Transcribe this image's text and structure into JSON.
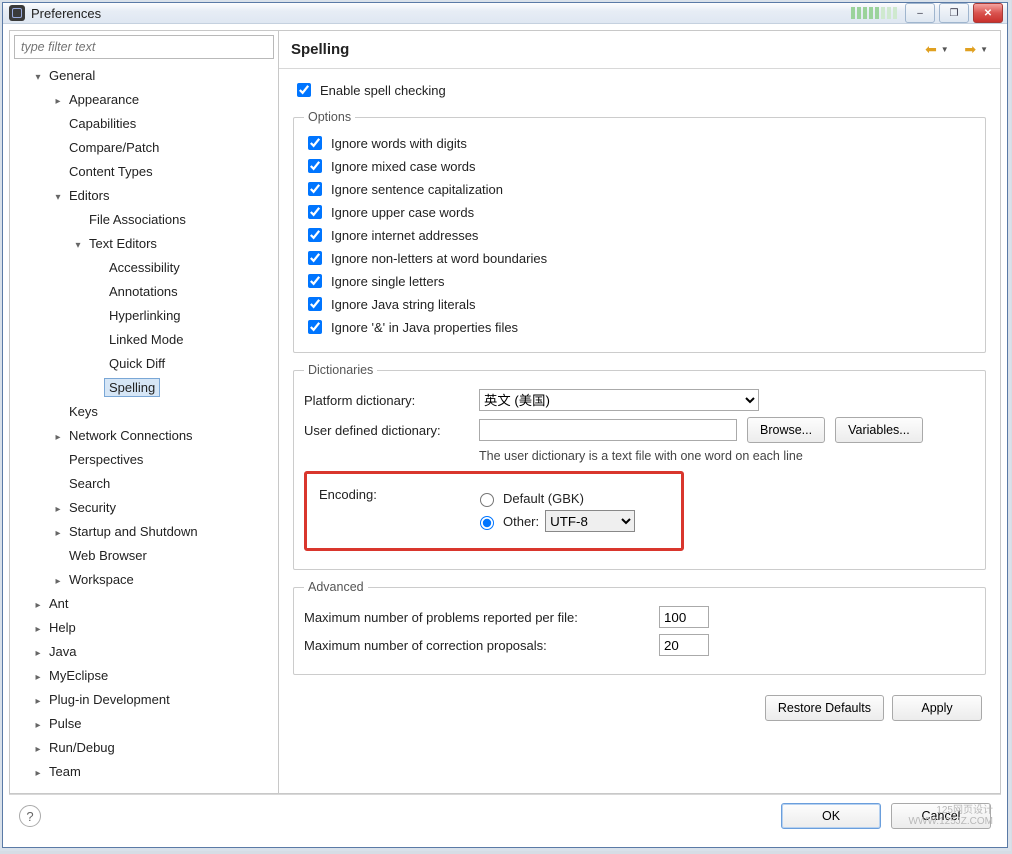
{
  "window": {
    "title": "Preferences"
  },
  "titlebar_buttons": {
    "min": "–",
    "max": "❐",
    "close": "✕"
  },
  "filter_placeholder": "type filter text",
  "tree": {
    "general": "General",
    "appearance": "Appearance",
    "capabilities": "Capabilities",
    "compare_patch": "Compare/Patch",
    "content_types": "Content Types",
    "editors": "Editors",
    "file_assoc": "File Associations",
    "text_editors": "Text Editors",
    "accessibility": "Accessibility",
    "annotations": "Annotations",
    "hyperlinking": "Hyperlinking",
    "linked_mode": "Linked Mode",
    "quick_diff": "Quick Diff",
    "spelling": "Spelling",
    "keys": "Keys",
    "network": "Network Connections",
    "perspectives": "Perspectives",
    "search": "Search",
    "security": "Security",
    "startup": "Startup and Shutdown",
    "web_browser": "Web Browser",
    "workspace": "Workspace",
    "ant": "Ant",
    "help": "Help",
    "java": "Java",
    "myeclipse": "MyEclipse",
    "plugin_dev": "Plug-in Development",
    "pulse": "Pulse",
    "run_debug": "Run/Debug",
    "team": "Team"
  },
  "page_title": "Spelling",
  "enable_label": "Enable spell checking",
  "options": {
    "legend": "Options",
    "digits": "Ignore words with digits",
    "mixed": "Ignore mixed case words",
    "sentence": "Ignore sentence capitalization",
    "upper": "Ignore upper case words",
    "internet": "Ignore internet addresses",
    "nonletters": "Ignore non-letters at word boundaries",
    "single": "Ignore single letters",
    "javastr": "Ignore Java string literals",
    "amp": "Ignore '&' in Java properties files"
  },
  "dictionaries": {
    "legend": "Dictionaries",
    "platform_label": "Platform dictionary:",
    "platform_value": "英文 (美国)",
    "user_label": "User defined dictionary:",
    "browse": "Browse...",
    "variables": "Variables...",
    "hint": "The user dictionary is a text file with one word on each line"
  },
  "encoding": {
    "label": "Encoding:",
    "default_label": "Default (GBK)",
    "other_label": "Other:",
    "other_value": "UTF-8"
  },
  "advanced": {
    "legend": "Advanced",
    "max_problems_label": "Maximum number of problems reported per file:",
    "max_problems_value": "100",
    "max_proposals_label": "Maximum number of correction proposals:",
    "max_proposals_value": "20"
  },
  "buttons": {
    "restore": "Restore Defaults",
    "apply": "Apply",
    "ok": "OK",
    "cancel": "Cancel"
  },
  "watermark": {
    "l1": "125网页设计",
    "l2": "WWW.125JZ.COM"
  }
}
